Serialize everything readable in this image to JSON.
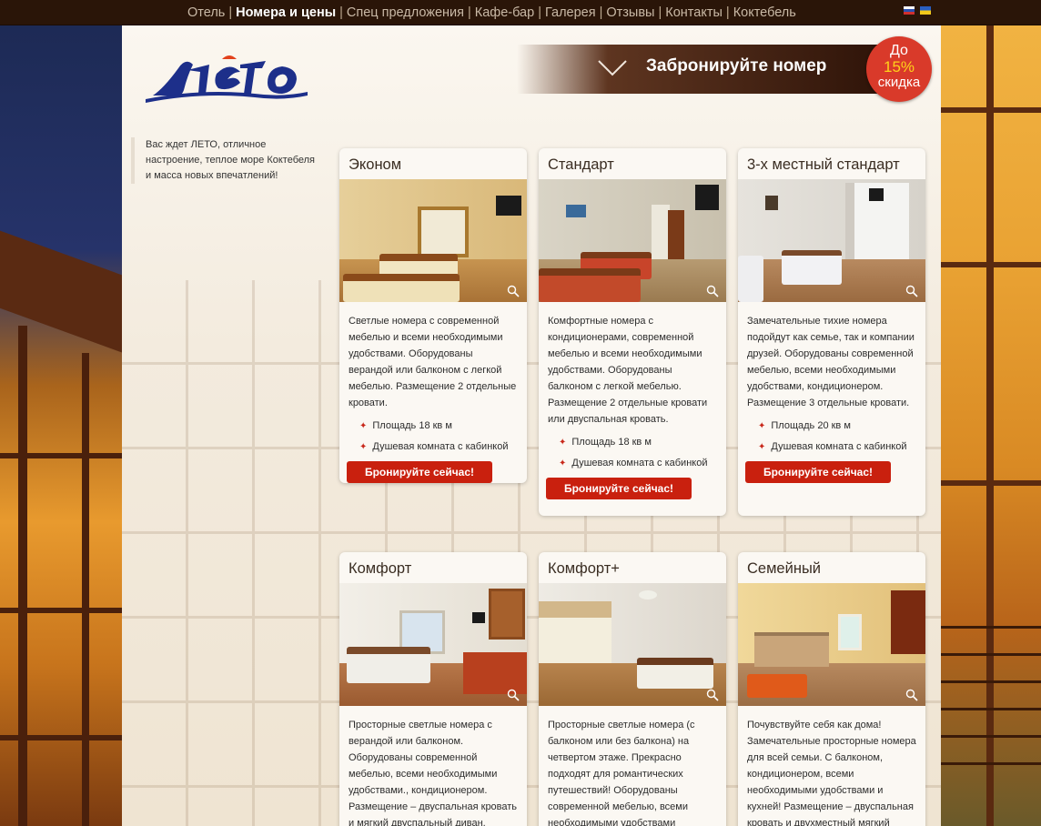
{
  "nav": {
    "items": [
      {
        "label": "Отель",
        "active": false
      },
      {
        "label": "Номера и цены",
        "active": true
      },
      {
        "label": "Спец предложения",
        "active": false
      },
      {
        "label": "Кафе-бар",
        "active": false
      },
      {
        "label": "Галерея",
        "active": false
      },
      {
        "label": "Отзывы",
        "active": false
      },
      {
        "label": "Контакты",
        "active": false
      },
      {
        "label": "Коктебель",
        "active": false
      }
    ],
    "separator": "|",
    "flags": [
      "ru-flag",
      "ua-flag"
    ]
  },
  "header": {
    "logo_text": "ЛЕТО",
    "book_label": "Забронируйте номер",
    "discount": {
      "line1": "До",
      "line2": "15%",
      "line3": "скидка"
    }
  },
  "intro": {
    "text": "Вас ждет ЛЕТО, отличное настроение, теплое море Коктебеля и масса новых впечатлений!"
  },
  "rooms": [
    {
      "title": "Эконом",
      "description": "Светлые номера с современной мебелью и всеми необходимыми удобствами. Оборудованы верандой или балконом с легкой мебелью. Размещение 2 отдельные кровати.",
      "features": [
        "Площадь 18 кв м",
        "Душевая комната с кабинкой"
      ],
      "button": "Бронируйте сейчас!"
    },
    {
      "title": "Стандарт",
      "description": "Комфортные номера с кондиционерами, современной мебелью и всеми необходимыми удобствами. Оборудованы балконом с легкой мебелью. Размещение 2 отдельные кровати или двуспальная кровать.",
      "features": [
        "Площадь 18 кв м",
        "Душевая комната с кабинкой"
      ],
      "button": "Бронируйте сейчас!"
    },
    {
      "title": "3-х местный стандарт",
      "description": "Замечательные тихие номера подойдут как семье, так и компании друзей. Оборудованы современной мебелью, всеми необходимыми удобствами, кондиционером. Размещение 3 отдельные кровати.",
      "features": [
        "Площадь 20 кв м",
        "Душевая комната с кабинкой"
      ],
      "button": "Бронируйте сейчас!"
    },
    {
      "title": "Комфорт",
      "description": "Просторные светлые номера с верандой или балконом. Оборудованы современной мебелью, всеми необходимыми удобствами., кондиционером. Размещение – двуспальная кровать и мягкий двуспальный диван."
    },
    {
      "title": "Комфорт+",
      "description": "Просторные светлые номера (с балконом или без балкона) на четвертом этаже. Прекрасно подходят для романтических путешествий! Оборудованы современной мебелью, всеми необходимыми удобствами"
    },
    {
      "title": "Семейный",
      "description": "Почувствуйте себя как дома! Замечательные просторные номера для всей семьи. С балконом, кондиционером, всеми необходимыми удобствами и кухней! Размещение – двуспальная кровать и двухместный мягкий диван."
    }
  ],
  "colors": {
    "topnav_bg": "#2a1508",
    "accent_red": "#c9200e",
    "discount_bg": "#d93a2a",
    "discount_highlight": "#ffd21a"
  }
}
